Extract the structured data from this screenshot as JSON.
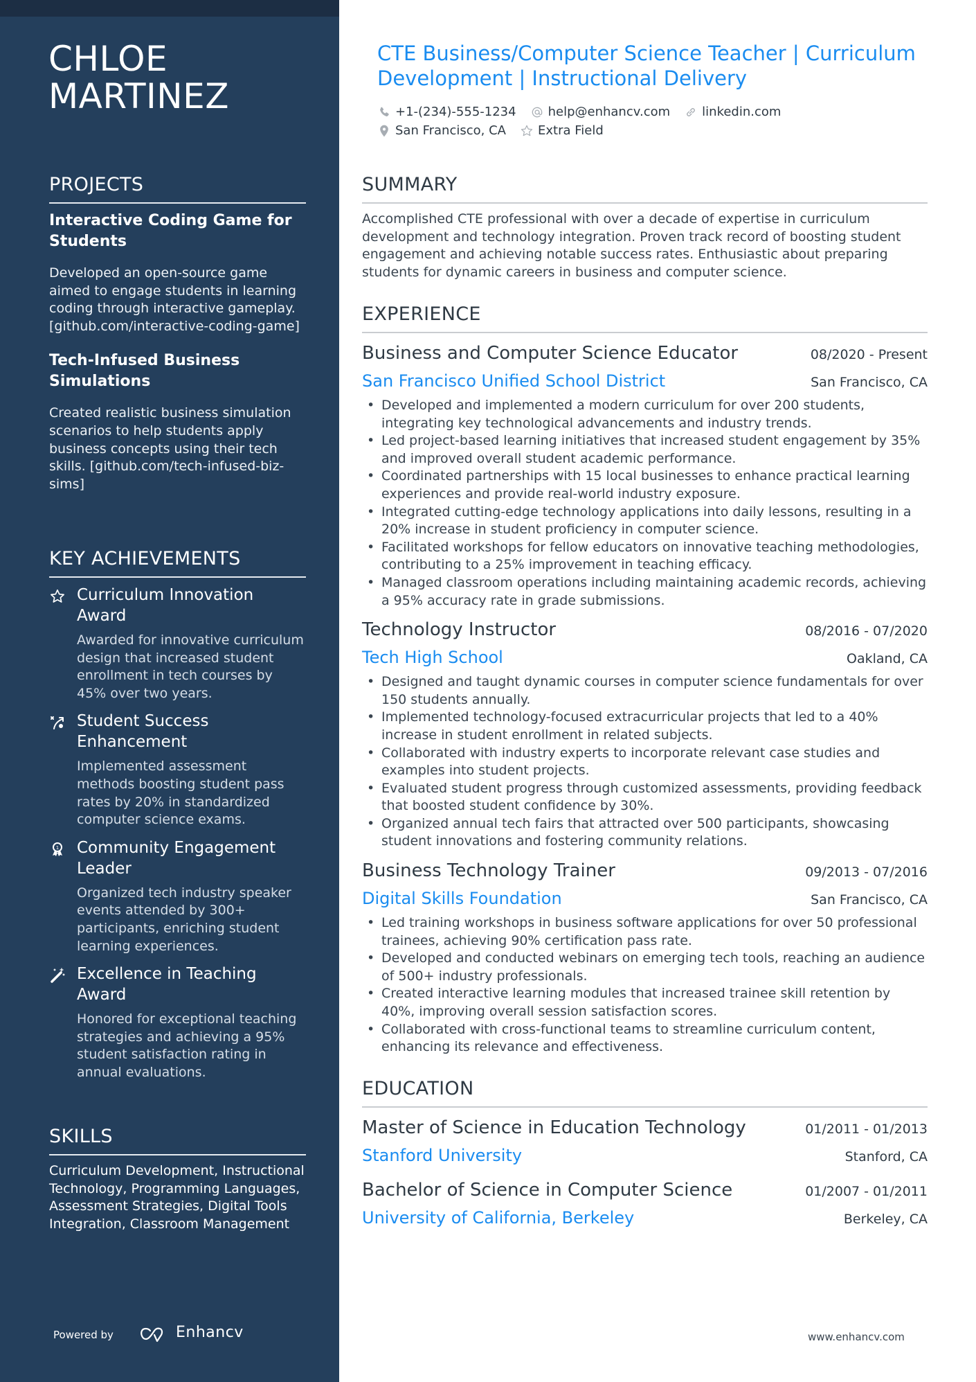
{
  "name": "CHLOE MARTINEZ",
  "name_lines": [
    "CHLOE",
    "MARTINEZ"
  ],
  "title": "CTE Business/Computer Science Teacher | Curriculum Development | Instructional Delivery",
  "contacts": {
    "phone": {
      "icon": "phone-icon",
      "text": "+1-(234)-555-1234"
    },
    "email": {
      "icon": "at-icon",
      "text": "help@enhancv.com"
    },
    "link": {
      "icon": "link-icon",
      "text": "linkedin.com"
    },
    "location": {
      "icon": "map-pin-icon",
      "text": "San Francisco, CA"
    },
    "extra": {
      "icon": "star-icon",
      "text": "Extra Field"
    }
  },
  "colors": {
    "sidebar": "#243f5c",
    "sidebar_topband": "#1c2e44",
    "accent": "#1a8cf0",
    "text": "#2f3a44"
  },
  "sidebar": {
    "projects": {
      "heading": "PROJECTS",
      "items": [
        {
          "title": "Interactive Coding Game for Students",
          "description": "Developed an open-source game aimed to engage students in learning coding through interactive gameplay. [github.com/interactive-coding-game]"
        },
        {
          "title": "Tech-Infused Business Simulations",
          "description": "Created realistic business simulation scenarios to help students apply business concepts using their tech skills. [github.com/tech-infused-biz-sims]"
        }
      ]
    },
    "achievements": {
      "heading": "KEY ACHIEVEMENTS",
      "items": [
        {
          "icon": "star-icon",
          "title": "Curriculum Innovation Award",
          "description": "Awarded for innovative curriculum design that increased student enrollment in tech courses by 45% over two years."
        },
        {
          "icon": "trajectory-icon",
          "title": "Student Success Enhancement",
          "description": "Implemented assessment methods boosting student pass rates by 20% in standardized computer science exams."
        },
        {
          "icon": "medal-icon",
          "title": "Community Engagement Leader",
          "description": "Organized tech industry speaker events attended by 300+ participants, enriching student learning experiences."
        },
        {
          "icon": "magic-wand-icon",
          "title": "Excellence in Teaching Award",
          "description": "Honored for exceptional teaching strategies and achieving a 95% student satisfaction rating in annual evaluations."
        }
      ]
    },
    "skills": {
      "heading": "SKILLS",
      "text": "Curriculum Development, Instructional Technology, Programming Languages, Assessment Strategies, Digital Tools Integration, Classroom Management"
    },
    "footer": {
      "powered_by": "Powered by",
      "brand": "Enhancv"
    }
  },
  "summary": {
    "heading": "SUMMARY",
    "text": "Accomplished CTE professional with over a decade of expertise in curriculum development and technology integration. Proven track record of boosting student engagement and achieving notable success rates. Enthusiastic about preparing students for dynamic careers in business and computer science."
  },
  "experience": {
    "heading": "EXPERIENCE",
    "jobs": [
      {
        "title": "Business and Computer Science Educator",
        "dates": "08/2020 - Present",
        "company": "San Francisco Unified School District",
        "location": "San Francisco, CA",
        "bullets": [
          "Developed and implemented a modern curriculum for over 200 students, integrating key technological advancements and industry trends.",
          "Led project-based learning initiatives that increased student engagement by 35% and improved overall student academic performance.",
          "Coordinated partnerships with 15 local businesses to enhance practical learning experiences and provide real-world industry exposure.",
          "Integrated cutting-edge technology applications into daily lessons, resulting in a 20% increase in student proficiency in computer science.",
          "Facilitated workshops for fellow educators on innovative teaching methodologies, contributing to a 25% improvement in teaching efficacy.",
          "Managed classroom operations including maintaining academic records, achieving a 95% accuracy rate in grade submissions."
        ]
      },
      {
        "title": "Technology Instructor",
        "dates": "08/2016 - 07/2020",
        "company": "Tech High School",
        "location": "Oakland, CA",
        "bullets": [
          "Designed and taught dynamic courses in computer science fundamentals for over 150 students annually.",
          "Implemented technology-focused extracurricular projects that led to a 40% increase in student enrollment in related subjects.",
          "Collaborated with industry experts to incorporate relevant case studies and examples into student projects.",
          "Evaluated student progress through customized assessments, providing feedback that boosted student confidence by 30%.",
          "Organized annual tech fairs that attracted over 500 participants, showcasing student innovations and fostering community relations."
        ]
      },
      {
        "title": "Business Technology Trainer",
        "dates": "09/2013 - 07/2016",
        "company": "Digital Skills Foundation",
        "location": "San Francisco, CA",
        "bullets": [
          "Led training workshops in business software applications for over 50 professional trainees, achieving 90% certification pass rate.",
          "Developed and conducted webinars on emerging tech tools, reaching an audience of 500+ industry professionals.",
          "Created interactive learning modules that increased trainee skill retention by 40%, improving overall session satisfaction scores.",
          "Collaborated with cross-functional teams to streamline curriculum content, enhancing its relevance and effectiveness."
        ]
      }
    ]
  },
  "education": {
    "heading": "EDUCATION",
    "items": [
      {
        "degree": "Master of Science in Education Technology",
        "dates": "01/2011 - 01/2013",
        "school": "Stanford University",
        "location": "Stanford, CA"
      },
      {
        "degree": "Bachelor of Science in Computer Science",
        "dates": "01/2007 - 01/2011",
        "school": "University of California, Berkeley",
        "location": "Berkeley, CA"
      }
    ]
  },
  "footer_url": "www.enhancv.com"
}
